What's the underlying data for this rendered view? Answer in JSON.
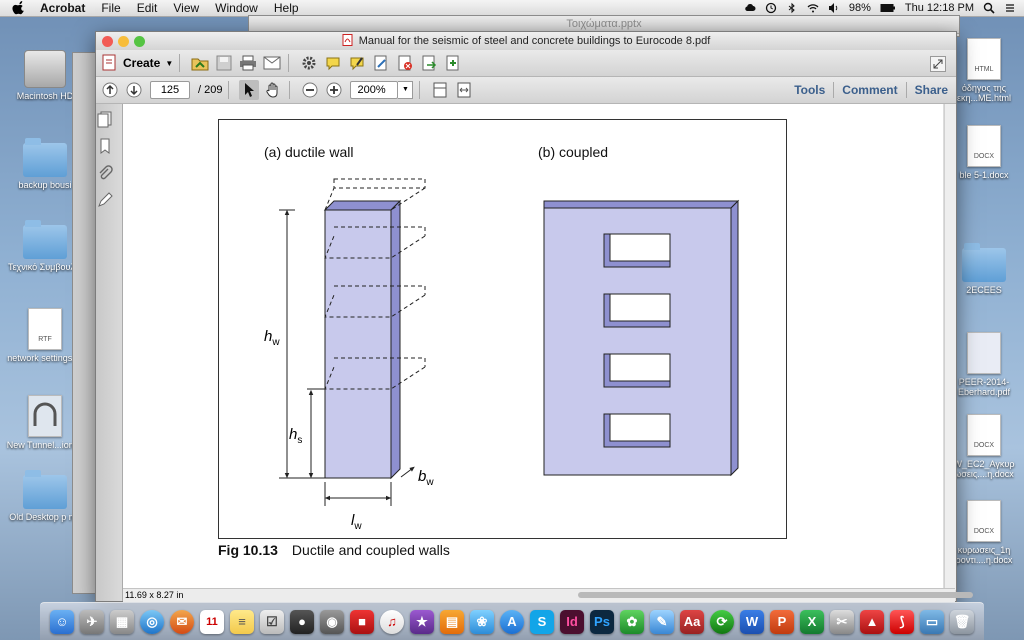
{
  "menubar": {
    "app": "Acrobat",
    "items": [
      "File",
      "Edit",
      "View",
      "Window",
      "Help"
    ],
    "battery": "98%",
    "clock": "Thu 12:18 PM"
  },
  "desktop_left": [
    {
      "label": "Macintosh HD",
      "kind": "hdd"
    },
    {
      "label": "backup bousi",
      "kind": "folder"
    },
    {
      "label": "Τεχνικό Συμβουλιο",
      "kind": "folder"
    },
    {
      "label": "network settings.rtf",
      "kind": "doc",
      "ext": "RTF"
    },
    {
      "label": "New Tunnel...ion.tif",
      "kind": "tif"
    },
    {
      "label": "Old Desktop p ms",
      "kind": "folder"
    }
  ],
  "desktop_right": [
    {
      "label": "όδηγος της εκη...ME.html",
      "kind": "doc",
      "ext": "HTML"
    },
    {
      "label": "ble 5-1.docx",
      "kind": "doc",
      "ext": "DOCX"
    },
    {
      "label": "2ECEES",
      "kind": "folder"
    },
    {
      "label": "PEER-2014-Eberhard.pdf",
      "kind": "doc",
      "ext": ""
    },
    {
      "label": "W_EC2_Αγκυρ ωσεις....η.docx",
      "kind": "doc",
      "ext": "DOCX"
    },
    {
      "label": "κυρωσεις_1η ροντι....η.docx",
      "kind": "doc",
      "ext": "DOCX"
    }
  ],
  "background_window_title": "Τοιχώματα.pptx",
  "window": {
    "title": "Manual for the seismic of steel and concrete buildings to Eurocode 8.pdf",
    "create_label": "Create",
    "page_current": "125",
    "page_total": "/ 209",
    "zoom": "200%",
    "tools_label": "Tools",
    "comment_label": "Comment",
    "share_label": "Share",
    "page_size": "11.69 x 8.27 in"
  },
  "figure": {
    "panel_a_title": "(a) ductile wall",
    "panel_b_title": "(b) coupled",
    "label_hw": "h",
    "label_hw_sub": "w",
    "label_hs": "h",
    "label_hs_sub": "s",
    "label_lw": "l",
    "label_lw_sub": "w",
    "label_bw": "b",
    "label_bw_sub": "w",
    "caption_number": "Fig 10.13",
    "caption_text": "Ductile and coupled walls",
    "wall_color": "#c8c9ec",
    "wall_side_color": "#8e90d0"
  },
  "dock_calendar_day": "11",
  "colors": {
    "accent_link": "#3b5f8c",
    "menubar_bg": "#e6e6e6"
  }
}
